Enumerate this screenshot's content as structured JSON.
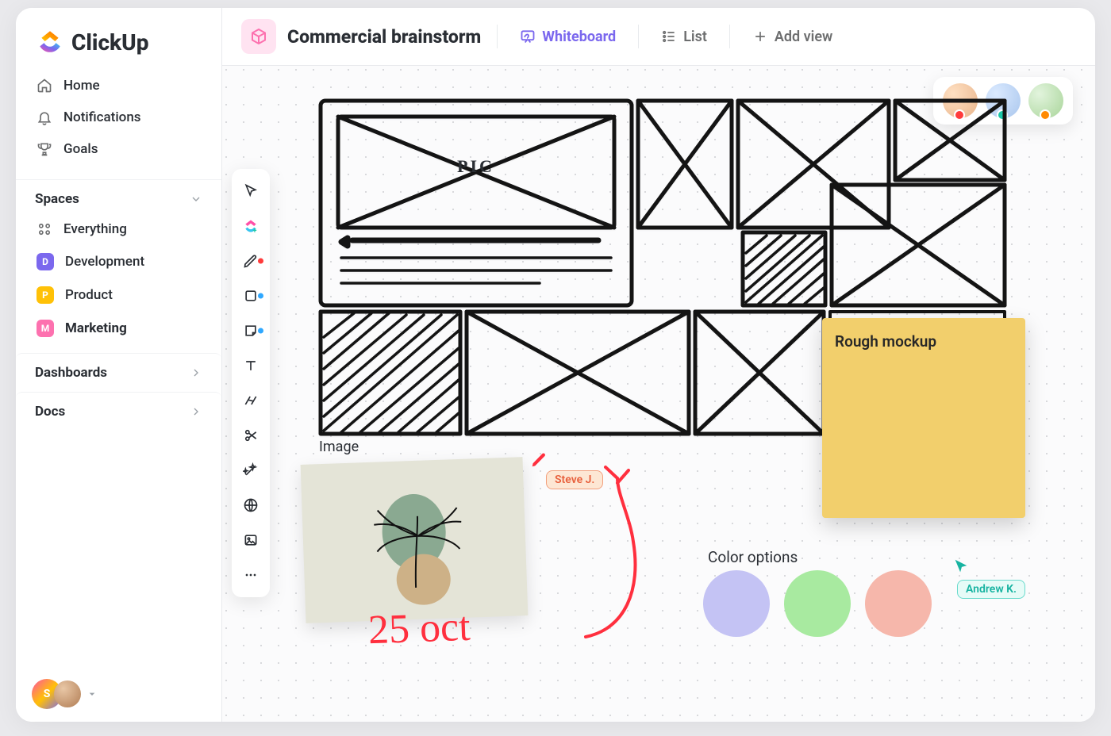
{
  "brand": "ClickUp",
  "sidebar": {
    "nav": [
      {
        "label": "Home"
      },
      {
        "label": "Notifications"
      },
      {
        "label": "Goals"
      }
    ],
    "spaces_header": "Spaces",
    "spaces": [
      {
        "label": "Everything",
        "chip": null
      },
      {
        "label": "Development",
        "letter": "D",
        "color": "#7b68ee"
      },
      {
        "label": "Product",
        "letter": "P",
        "color": "#ffc107"
      },
      {
        "label": "Marketing",
        "letter": "M",
        "color": "#fd71af",
        "active": true
      }
    ],
    "sections": [
      {
        "label": "Dashboards"
      },
      {
        "label": "Docs"
      }
    ],
    "user_letter": "S"
  },
  "header": {
    "title": "Commercial brainstorm",
    "views": [
      {
        "label": "Whiteboard",
        "active": true
      },
      {
        "label": "List"
      }
    ],
    "add_view": "Add view"
  },
  "tools": [
    {
      "name": "select-tool"
    },
    {
      "name": "clickup-task-tool"
    },
    {
      "name": "pen-tool",
      "dot": "#ff3b3b"
    },
    {
      "name": "shape-tool",
      "dot": "#2fa8ff"
    },
    {
      "name": "sticky-tool",
      "dot": "#2fa8ff"
    },
    {
      "name": "text-tool"
    },
    {
      "name": "connector-tool"
    },
    {
      "name": "scissors-tool"
    },
    {
      "name": "magic-tool"
    },
    {
      "name": "web-embed-tool"
    },
    {
      "name": "image-tool"
    },
    {
      "name": "more-tools"
    }
  ],
  "canvas": {
    "sketch_pic_label": "PIC",
    "sticky_note": "Rough mockup",
    "image_label": "Image",
    "handwriting": "25 oct",
    "color_options_label": "Color options",
    "swatches": [
      "#c4c3f4",
      "#a8eaa0",
      "#f6b7ab"
    ],
    "cursors": {
      "steve": "Steve J.",
      "andrew": "Andrew K."
    }
  }
}
